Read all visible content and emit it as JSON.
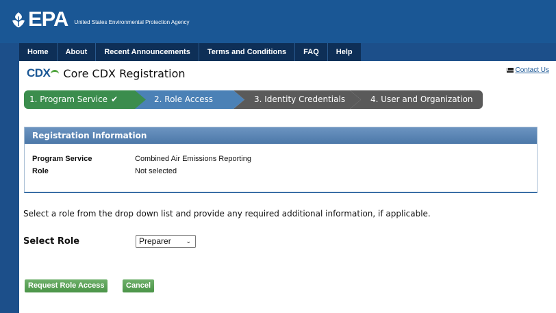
{
  "header": {
    "logo": "EPA",
    "agency": "United States Environmental Protection Agency"
  },
  "nav": {
    "items": [
      "Home",
      "About",
      "Recent Announcements",
      "Terms and Conditions",
      "FAQ",
      "Help"
    ]
  },
  "contact_label": "Contact Us",
  "cdx_logo": "CDX",
  "page_title": "Core CDX Registration",
  "steps": [
    {
      "label": "1. Program Service",
      "status": "complete"
    },
    {
      "label": "2. Role Access",
      "status": "current"
    },
    {
      "label": "3. Identity Credentials",
      "status": "pending"
    },
    {
      "label": "4. User and Organization",
      "status": "pending"
    }
  ],
  "step_check": "✔",
  "registration_info": {
    "heading": "Registration Information",
    "rows": [
      {
        "key": "Program Service",
        "value": "Combined Air Emissions Reporting"
      },
      {
        "key": "Role",
        "value": "Not selected"
      }
    ]
  },
  "instructions": "Select a role from the drop down list and provide any required additional information, if applicable.",
  "select_role": {
    "label": "Select Role",
    "value": "Preparer"
  },
  "buttons": {
    "request": "Request Role Access",
    "cancel": "Cancel"
  },
  "colors": {
    "header_blue": "#1a5795",
    "nav_dark": "#0e2f57",
    "step_complete": "#3b8d4d",
    "step_current": "#4b81b6",
    "step_pending": "#5a5a5a",
    "button_green": "#5aa05a"
  }
}
